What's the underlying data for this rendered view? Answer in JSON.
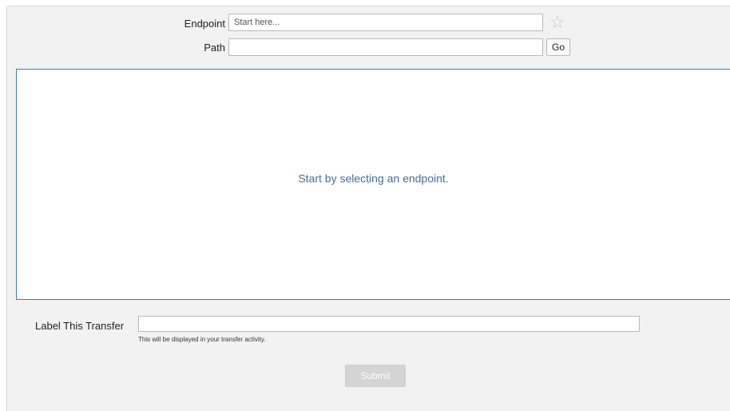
{
  "endpoint": {
    "label": "Endpoint",
    "placeholder": "Start here...",
    "value": "",
    "favorite_icon": "star-outline-icon"
  },
  "path": {
    "label": "Path",
    "value": "",
    "go_label": "Go"
  },
  "browser": {
    "empty_message": "Start by selecting an endpoint."
  },
  "transfer_label": {
    "label": "Label This Transfer",
    "value": "",
    "help": "This will be displayed in your transfer activity."
  },
  "submit": {
    "label": "Submit"
  },
  "colors": {
    "accent_border": "#4a78ab",
    "message_text": "#4b6c91",
    "submit_disabled_bg": "#d4d4d4"
  }
}
